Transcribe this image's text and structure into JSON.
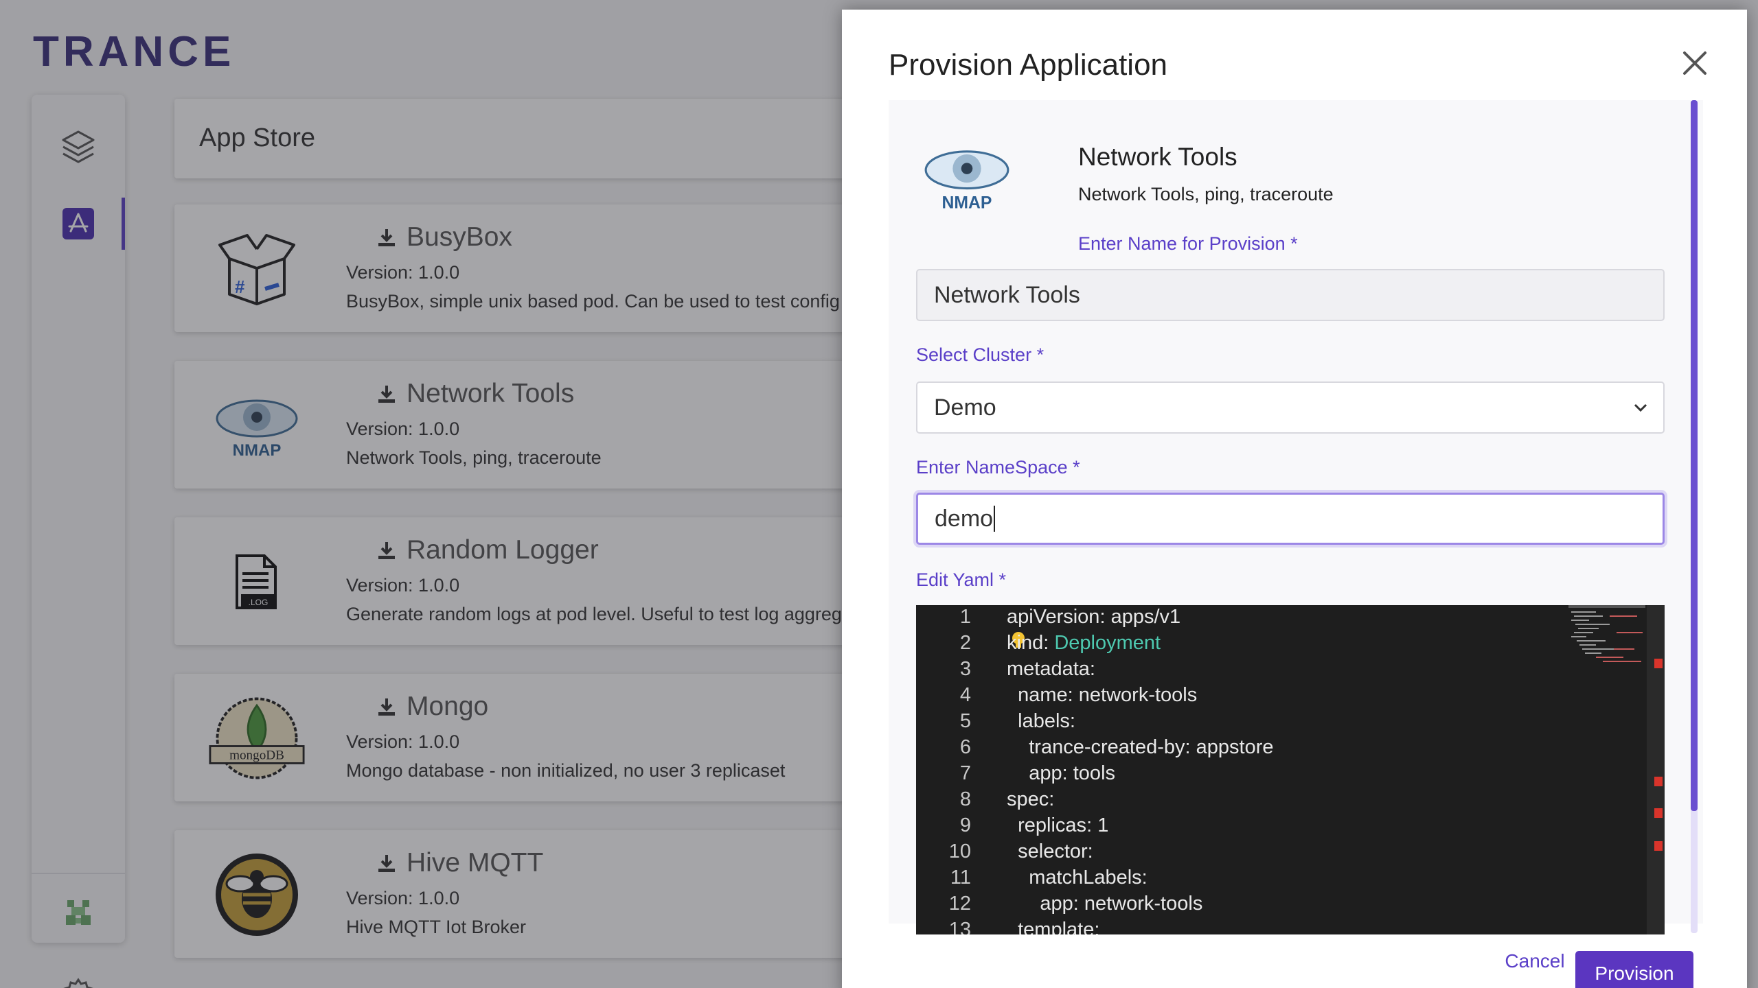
{
  "app": {
    "logo_text": "TRANCE",
    "page_title": "App Store"
  },
  "cards": [
    {
      "name": "BusyBox",
      "version": "Version: 1.0.0",
      "description": "BusyBox, simple unix based pod. Can be used to test config",
      "icon": "busybox-box-icon"
    },
    {
      "name": "Network Tools",
      "version": "Version: 1.0.0",
      "description": "Network Tools, ping, traceroute",
      "icon": "nmap-eye-icon"
    },
    {
      "name": "Random Logger",
      "version": "Version: 1.0.0",
      "description": "Generate random logs at pod level. Useful to test log aggreg",
      "icon": "log-file-icon"
    },
    {
      "name": "Mongo",
      "version": "Version: 1.0.0",
      "description": "Mongo database - non initialized, no user 3 replicaset",
      "icon": "mongodb-leaf-icon"
    },
    {
      "name": "Hive MQTT",
      "version": "Version: 1.0.0",
      "description": "Hive MQTT Iot Broker",
      "icon": "hive-bee-icon"
    }
  ],
  "modal": {
    "title": "Provision Application",
    "app_name": "Network Tools",
    "app_description": "Network Tools, ping, traceroute",
    "name_label": "Enter Name for Provision *",
    "name_value": "Network Tools",
    "cluster_label": "Select Cluster *",
    "cluster_value": "Demo",
    "namespace_label": "Enter NameSpace *",
    "namespace_value": "demo",
    "yaml_label": "Edit Yaml *",
    "cancel_label": "Cancel",
    "provision_label": "Provision"
  },
  "yaml_lines": [
    {
      "n": "1",
      "key": "apiVersion",
      "val": "apps/v1",
      "indent": ""
    },
    {
      "n": "2",
      "key": "kind",
      "val": "Deployment",
      "indent": "",
      "val_kw": true
    },
    {
      "n": "3",
      "key": "metadata",
      "val": "",
      "indent": ""
    },
    {
      "n": "4",
      "key": "name",
      "val": "network-tools",
      "indent": "  "
    },
    {
      "n": "5",
      "key": "labels",
      "val": "",
      "indent": "  "
    },
    {
      "n": "6",
      "key": "trance-created-by",
      "val": "appstore",
      "indent": "    "
    },
    {
      "n": "7",
      "key": "app",
      "val": "tools",
      "indent": "    "
    },
    {
      "n": "8",
      "key": "spec",
      "val": "",
      "indent": ""
    },
    {
      "n": "9",
      "key": "replicas",
      "val": "1",
      "indent": "  "
    },
    {
      "n": "10",
      "key": "selector",
      "val": "",
      "indent": "  "
    },
    {
      "n": "11",
      "key": "matchLabels",
      "val": "",
      "indent": "    "
    },
    {
      "n": "12",
      "key": "app",
      "val": "network-tools",
      "indent": "      "
    },
    {
      "n": "13",
      "key": "template",
      "val": "",
      "indent": "  "
    }
  ],
  "colors": {
    "accent": "#5b36c0",
    "label": "#5a3fc8",
    "editor_bg": "#1e1e1e",
    "yaml_keyword": "#4ec9b0"
  }
}
